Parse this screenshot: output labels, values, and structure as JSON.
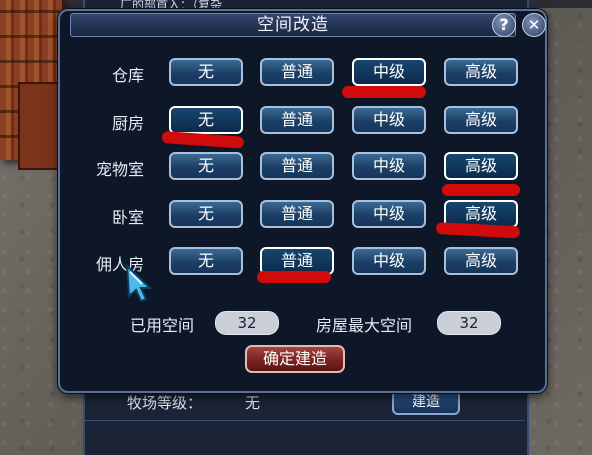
{
  "background": {
    "under_panel": {
      "top_text": "厂的部首入：（复杂",
      "ranch_label": "牧场等级：",
      "ranch_value": "无",
      "build_button": "建造"
    }
  },
  "dialog": {
    "title": "空间改造",
    "help_icon": "question-icon",
    "close_icon": "close-icon",
    "rooms": [
      {
        "name": "仓库",
        "options": [
          "无",
          "普通",
          "中级",
          "高级"
        ],
        "selected": "中级"
      },
      {
        "name": "厨房",
        "options": [
          "无",
          "普通",
          "中级",
          "高级"
        ],
        "selected": "无"
      },
      {
        "name": "宠物室",
        "options": [
          "无",
          "普通",
          "中级",
          "高级"
        ],
        "selected": "高级"
      },
      {
        "name": "卧室",
        "options": [
          "无",
          "普通",
          "中级",
          "高级"
        ],
        "selected": "高级"
      },
      {
        "name": "佣人房",
        "options": [
          "无",
          "普通",
          "中级",
          "高级"
        ],
        "selected": "普通"
      }
    ],
    "used_space_label": "已用空间",
    "used_space_value": "32",
    "max_space_label": "房屋最大空间",
    "max_space_value": "32",
    "confirm_button": "确定建造"
  },
  "colors": {
    "annotation_red": "#d10b0b",
    "dialog_bg": "#0e1727",
    "button_blue": "#1c3f66",
    "confirm_red": "#7a2320"
  }
}
